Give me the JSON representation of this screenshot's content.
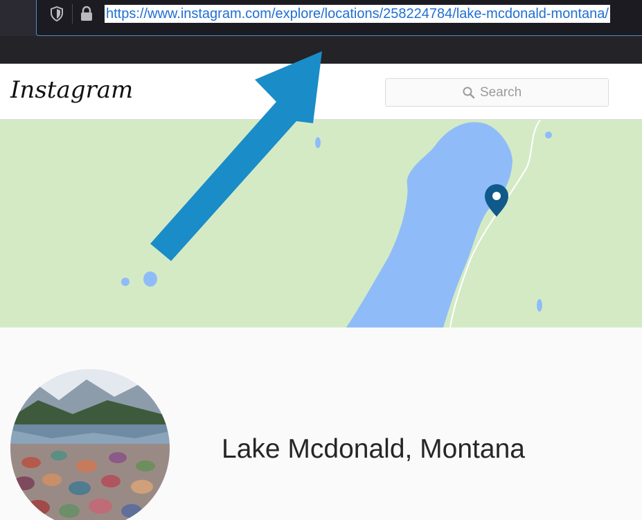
{
  "browser": {
    "url": "https://www.instagram.com/explore/locations/258224784/lake-mcdonald-montana/",
    "icons": [
      "shield-icon",
      "lock-icon"
    ]
  },
  "header": {
    "logo_text": "Instagram",
    "search_placeholder": "Search",
    "icons": [
      "search-icon"
    ]
  },
  "map": {
    "marker_icon": "map-pin-icon",
    "water_color": "#8fbcf8",
    "land_color": "#d4eac5",
    "marker_color": "#0f5a8a"
  },
  "annotation": {
    "arrow_color": "#1a8cc8"
  },
  "location": {
    "name": "Lake Mcdonald, Montana"
  }
}
